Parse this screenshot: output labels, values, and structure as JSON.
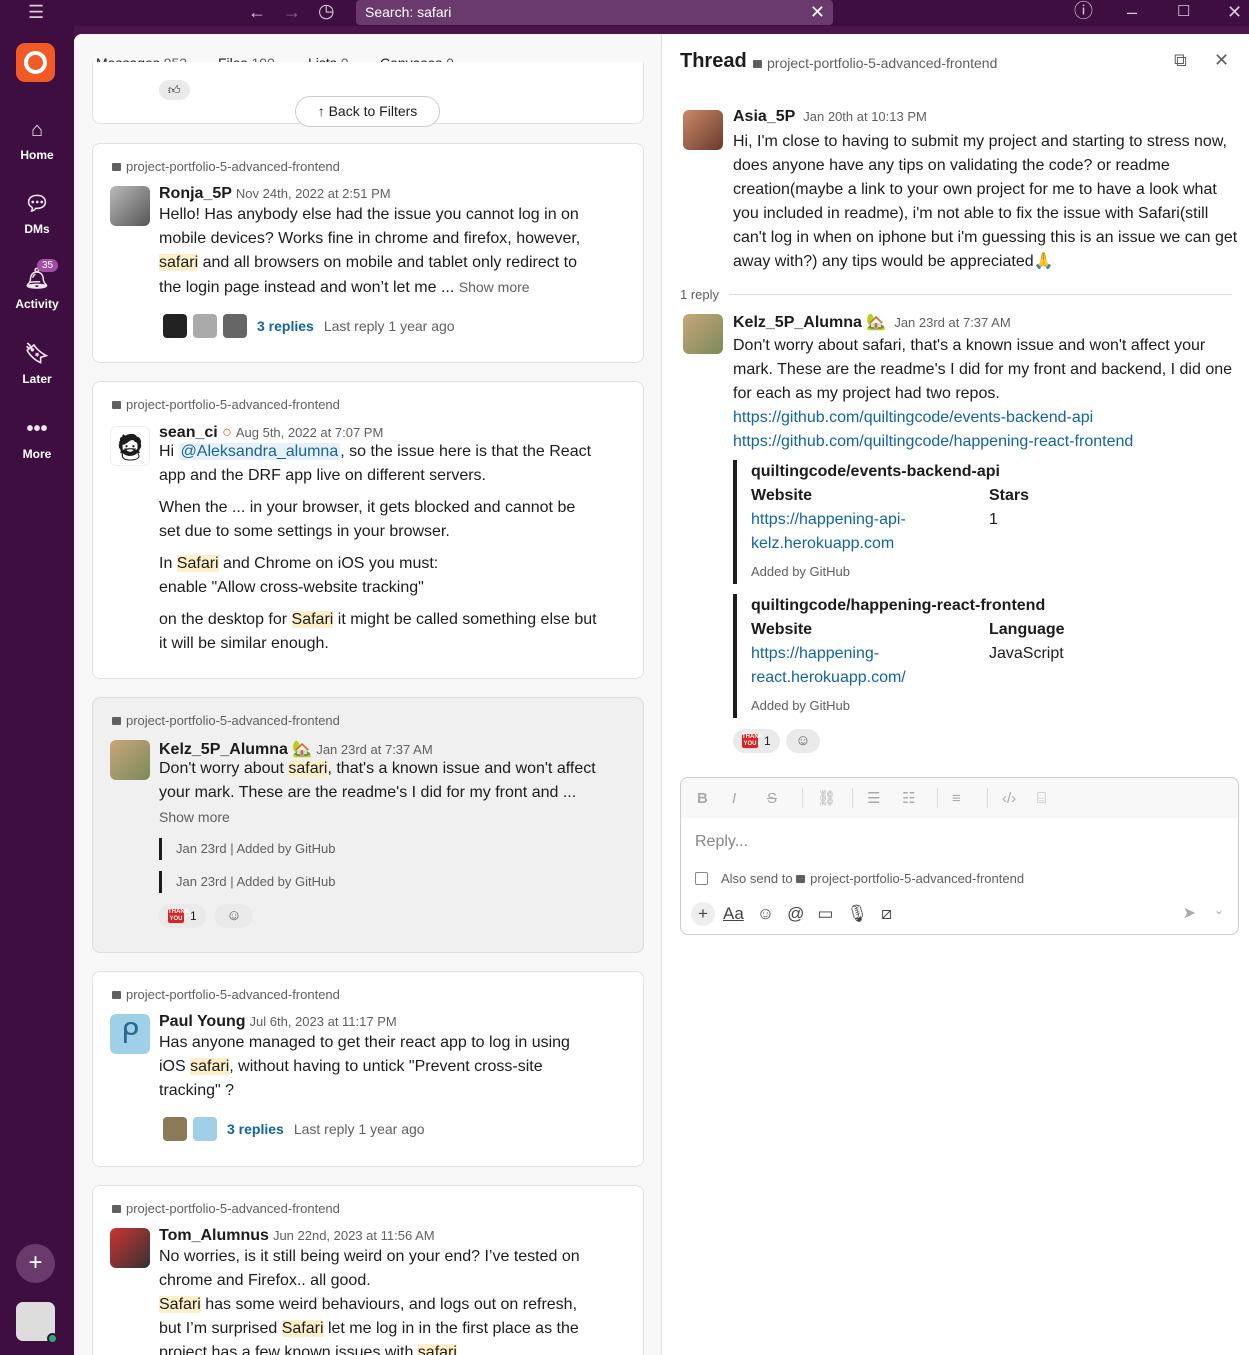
{
  "search": {
    "value": "Search: safari"
  },
  "rail": {
    "home": "Home",
    "dms": "DMs",
    "activity": "Activity",
    "activity_badge": "35",
    "later": "Later",
    "more": "More"
  },
  "tabs": [
    {
      "label": "Messages",
      "count": "952"
    },
    {
      "label": "Files",
      "count": "190"
    },
    {
      "label": "Lists",
      "count": "0"
    },
    {
      "label": "Canvases",
      "count": "0"
    }
  ],
  "back_label": "Back to Filters",
  "channel": "project-portfolio-5-advanced-frontend",
  "results": [
    {
      "user": "Ronja_5P",
      "time": "Nov 24th, 2022 at 2:51 PM",
      "t1": "Hello! Has anybody else had the issue you cannot log in on mobile devices? Works fine in chrome and firefox, however, ",
      "hl1": "safari",
      "t2": " and all browsers on mobile and tablet only redirect to the login page instead and won’t let me ... ",
      "show_more": "Show more",
      "replies": "3 replies",
      "last_reply": "Last reply 1 year ago"
    },
    {
      "user": "sean_ci",
      "time": "Aug 5th, 2022 at 7:07 PM",
      "p1a": "Hi ",
      "mention": "@Aleksandra_alumna",
      "p1b": ", so the issue here is that the React app and the DRF app live on different servers.",
      "p2": "When the ... in your browser, it gets blocked and cannot be set due to some settings in your browser.",
      "p3a": "In ",
      "hl3": "Safari",
      "p3b": "  and Chrome on iOS you must:",
      "p3c": "enable \"Allow cross-website tracking\"",
      "p4a": "on the desktop for ",
      "hl4": "Safari",
      "p4b": " it might be called something else but it will be similar enough."
    },
    {
      "user": "Kelz_5P_Alumna",
      "time": "Jan 23rd at 7:37 AM",
      "t1": "Don't worry about ",
      "hl1": "safari",
      "t2": ", that's a known issue and won't affect your mark. These are the readme's I did for my front and ... ",
      "show_more": "Show more",
      "att1": "Jan 23rd",
      "att1b": "Added by GitHub",
      "att2": "Jan 23rd",
      "att2b": "Added by GitHub",
      "react_count": "1"
    },
    {
      "user": "Paul Young",
      "time": "Jul 6th, 2023 at 11:17 PM",
      "t1": "Has anyone managed to get their react app to log in using iOS ",
      "hl1": "safari",
      "t2": ", without having to untick \"Prevent cross-site tracking\" ?",
      "replies": "3 replies",
      "last_reply": "Last reply 1 year ago"
    },
    {
      "user": "Tom_Alumnus",
      "time": "Jun 22nd, 2023 at 11:56 AM",
      "t1": "No worries, is it still being weird on your end? I’ve tested on chrome and Firefox.. all good.",
      "hl2": "Safari",
      "t2": " has some weird behaviours, and logs out on refresh, but I’m surprised ",
      "hl3": "Safari",
      "t3": " let me log in in the first place as the project has a few known issues with ",
      "hl4": "safari"
    }
  ],
  "thread": {
    "title": "Thread",
    "channel": "project-portfolio-5-advanced-frontend",
    "root": {
      "user": "Asia_5P",
      "time": "Jan 20th at 10:13 PM",
      "text": "Hi, I'm close to having to submit my project and starting to stress now, does anyone have any tips on validating the code? or readme creation(maybe a link to your own project for me to have a look what you included in readme), i'm not able to fix the issue with Safari(still can't log in when on iphone but i'm guessing this is an issue we can get away with?) any tips would be appreciated🙏"
    },
    "reply_count": "1 reply",
    "reply": {
      "user": "Kelz_5P_Alumna",
      "time": "Jan 23rd at 7:37 AM",
      "text": "Don't worry about safari, that's a known issue and won't affect your mark. These are the readme's I did for my front and backend, I did one for each as my project had two repos.",
      "link1": "https://github.com/quiltingcode/events-backend-api",
      "link2": "https://github.com/quiltingcode/happening-react-frontend",
      "unfurl1": {
        "title": "quiltingcode/events-backend-api",
        "k1": "Website",
        "k2": "Stars",
        "v1": "https://happening-api-kelz.herokuapp.com",
        "v2": "1",
        "footer": "Added by GitHub"
      },
      "unfurl2": {
        "title": "quiltingcode/happening-react-frontend",
        "k1": "Website",
        "k2": "Language",
        "v1": "https://happening-react.herokuapp.com/",
        "v2": "JavaScript",
        "footer": "Added by GitHub"
      },
      "react_count": "1"
    },
    "composer": {
      "placeholder": "Reply...",
      "also_send": "Also send to",
      "also_channel": "project-portfolio-5-advanced-frontend"
    }
  }
}
